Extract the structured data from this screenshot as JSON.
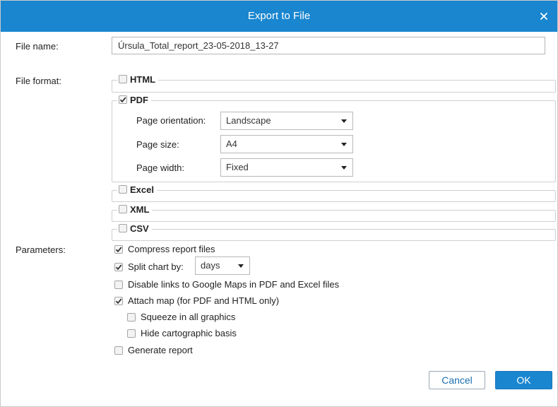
{
  "dialog": {
    "title": "Export to File"
  },
  "file_name": {
    "label": "File name:",
    "value": "Úrsula_Total_report_23-05-2018_13-27"
  },
  "file_format": {
    "label": "File format:",
    "html": {
      "label": "HTML",
      "checked": false
    },
    "pdf": {
      "label": "PDF",
      "checked": true,
      "orientation": {
        "label": "Page orientation:",
        "value": "Landscape"
      },
      "size": {
        "label": "Page size:",
        "value": "A4"
      },
      "width": {
        "label": "Page width:",
        "value": "Fixed"
      }
    },
    "excel": {
      "label": "Excel",
      "checked": false
    },
    "xml": {
      "label": "XML",
      "checked": false
    },
    "csv": {
      "label": "CSV",
      "checked": false
    }
  },
  "parameters": {
    "label": "Parameters:",
    "compress": {
      "label": "Compress report files",
      "checked": true
    },
    "split_chart": {
      "label": "Split chart by:",
      "checked": true,
      "value": "days"
    },
    "disable_links": {
      "label": "Disable links to Google Maps in PDF and Excel files",
      "checked": false
    },
    "attach_map": {
      "label": "Attach map (for PDF and HTML only)",
      "checked": true
    },
    "squeeze": {
      "label": "Squeeze in all graphics",
      "checked": false
    },
    "hide_basis": {
      "label": "Hide cartographic basis",
      "checked": false
    },
    "generate": {
      "label": "Generate report",
      "checked": false
    }
  },
  "buttons": {
    "cancel": "Cancel",
    "ok": "OK"
  },
  "colors": {
    "accent": "#1a86d0",
    "border": "#cfcfcf",
    "cancel_text": "#1a6fb0"
  },
  "icons": {
    "close": "close-icon",
    "check": "checkmark-icon",
    "dropdown": "chevron-down-icon"
  }
}
